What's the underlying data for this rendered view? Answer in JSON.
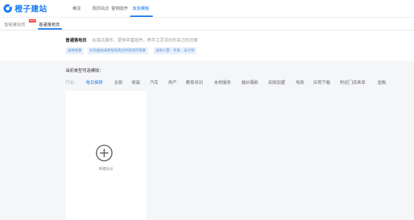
{
  "brand": {
    "name": "橙子建站",
    "color": "#1a7cf0"
  },
  "nav": {
    "items": [
      {
        "label": "概览"
      },
      {
        "label": "我的站点"
      },
      {
        "label": "营销组件"
      },
      {
        "label": "发现模板"
      }
    ]
  },
  "subtabs": {
    "items": [
      {
        "label": "智能建站页"
      },
      {
        "label": "普通落地页"
      }
    ],
    "badge": "NEW"
  },
  "intro": {
    "title": "普通落地页",
    "desc": "标准式操作，提供丰富组件，跨手工灵活创作自己的页面",
    "tags": [
      "适用场景",
      "对页面自由度有较高创作需求的场景",
      "适用人群：专家、设计师"
    ]
  },
  "section": {
    "label": "当前类型可选模版：",
    "prefix": "行业：",
    "categories": [
      "每日推荐",
      "全部",
      "家装",
      "汽车",
      "房产",
      "教育培训",
      "本地服务",
      "婚纱摄影",
      "招商加盟",
      "电商",
      "应用下载",
      "附近门店表单",
      "金融"
    ]
  },
  "card": {
    "label": "新建站点"
  }
}
